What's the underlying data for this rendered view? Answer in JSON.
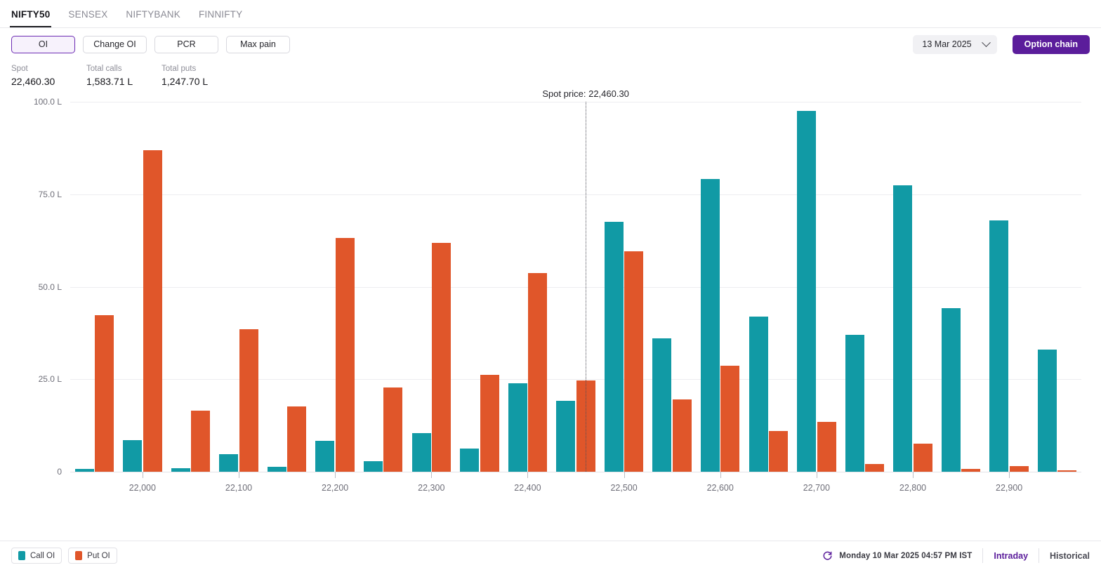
{
  "tabs": [
    {
      "label": "NIFTY50",
      "active": true
    },
    {
      "label": "SENSEX",
      "active": false
    },
    {
      "label": "NIFTYBANK",
      "active": false
    },
    {
      "label": "FINNIFTY",
      "active": false
    }
  ],
  "toolbar": {
    "metrics": [
      {
        "label": "OI",
        "active": true
      },
      {
        "label": "Change OI",
        "active": false
      },
      {
        "label": "PCR",
        "active": false
      },
      {
        "label": "Max pain",
        "active": false
      }
    ],
    "expiry": "13 Mar 2025",
    "expiry_chevron": "chevron-down-icon",
    "option_chain_label": "Option chain"
  },
  "stats": [
    {
      "label": "Spot",
      "value": "22,460.30"
    },
    {
      "label": "Total calls",
      "value": "1,583.71 L"
    },
    {
      "label": "Total puts",
      "value": "1,247.70 L"
    }
  ],
  "footer": {
    "legend": [
      {
        "label": "Call OI",
        "color": "#119aa5"
      },
      {
        "label": "Put OI",
        "color": "#e0562a"
      }
    ],
    "refresh_icon": "refresh-icon",
    "timestamp": "Monday 10 Mar 2025 04:57 PM IST",
    "views": [
      {
        "label": "Intraday",
        "active": true
      },
      {
        "label": "Historical",
        "active": false
      }
    ]
  },
  "chart_data": {
    "type": "bar",
    "title": "",
    "xlabel": "",
    "ylabel": "",
    "grid": true,
    "legend_position": "bottom-left",
    "ylim": [
      0,
      100
    ],
    "yticks": [
      0,
      25,
      50,
      75,
      100
    ],
    "ytick_labels": [
      "0",
      "25.0 L",
      "50.0 L",
      "75.0 L",
      "100.0 L"
    ],
    "unit": "L",
    "xticks": [
      22000,
      22100,
      22200,
      22300,
      22400,
      22500,
      22600,
      22700,
      22800,
      22900
    ],
    "xtick_labels": [
      "22,000",
      "22,100",
      "22,200",
      "22,300",
      "22,400",
      "22,500",
      "22,600",
      "22,700",
      "22,800",
      "22,900"
    ],
    "xlim": [
      21925,
      22975
    ],
    "annotation": {
      "label": "Spot price: 22,460.30",
      "x": 22460.3
    },
    "categories": [
      21950,
      22000,
      22050,
      22100,
      22150,
      22200,
      22250,
      22300,
      22350,
      22400,
      22450,
      22500,
      22550,
      22600,
      22650,
      22700,
      22750,
      22800,
      22850,
      22900,
      22950
    ],
    "series": [
      {
        "name": "Call OI",
        "color": "#119aa5",
        "values": [
          0.7,
          8.6,
          1.0,
          4.8,
          1.3,
          8.3,
          2.9,
          10.4,
          6.2,
          24.0,
          19.2,
          67.5,
          36.0,
          79.2,
          42.0,
          97.5,
          37.0,
          77.5,
          44.2,
          68.0,
          33.0
        ]
      },
      {
        "name": "Put OI",
        "color": "#e0562a",
        "values": [
          42.3,
          87.0,
          16.5,
          38.5,
          17.6,
          63.2,
          22.7,
          61.8,
          26.2,
          53.7,
          24.6,
          59.5,
          19.5,
          28.6,
          11.0,
          13.4,
          2.0,
          7.5,
          0.8,
          1.5,
          0.4
        ]
      }
    ]
  }
}
